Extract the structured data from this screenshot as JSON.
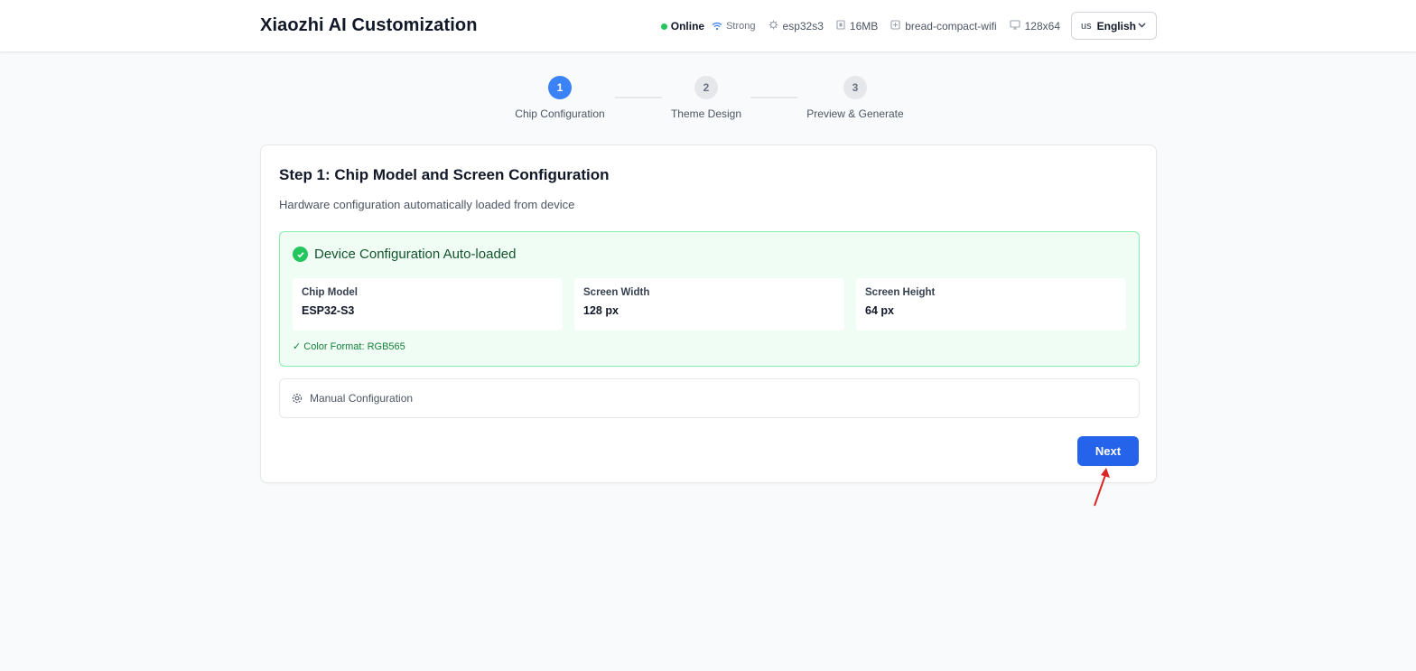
{
  "header": {
    "title": "Xiaozhi AI Customization",
    "status": {
      "online": "Online",
      "signal": "Strong",
      "chip": "esp32s3",
      "flash": "16MB",
      "board": "bread-compact-wifi",
      "resolution": "128x64"
    },
    "language": {
      "flag": "us",
      "selected": "English"
    }
  },
  "stepper": {
    "steps": [
      {
        "number": "1",
        "label": "Chip Configuration",
        "state": "active"
      },
      {
        "number": "2",
        "label": "Theme Design",
        "state": "inactive"
      },
      {
        "number": "3",
        "label": "Preview & Generate",
        "state": "inactive"
      }
    ]
  },
  "card": {
    "title": "Step 1: Chip Model and Screen Configuration",
    "subtitle": "Hardware configuration automatically loaded from device",
    "autoload": {
      "heading": "Device Configuration Auto-loaded",
      "fields": [
        {
          "label": "Chip Model",
          "value": "ESP32-S3"
        },
        {
          "label": "Screen Width",
          "value": "128 px"
        },
        {
          "label": "Screen Height",
          "value": "64 px"
        }
      ],
      "color_format": "✓ Color Format: RGB565"
    },
    "manual_label": "Manual Configuration",
    "next_label": "Next"
  },
  "colors": {
    "accent": "#2563eb",
    "step_active": "#3b82f6",
    "success_bg": "#f0fdf4",
    "success_border": "#86efac",
    "online_dot": "#22c55e",
    "annotation_arrow": "#dc2626"
  },
  "icons": [
    "wifi-icon",
    "chip-icon",
    "memory-icon",
    "board-icon",
    "monitor-icon",
    "chevron-down-icon",
    "check-circle-icon",
    "gear-icon",
    "annotation-arrow"
  ]
}
